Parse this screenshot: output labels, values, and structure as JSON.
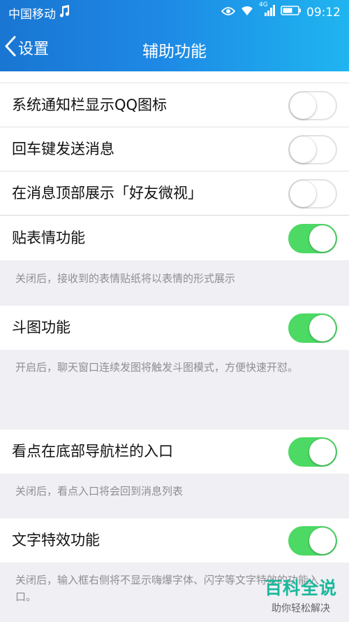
{
  "status_bar": {
    "carrier": "中国移动",
    "network": "4G",
    "time": "09:12"
  },
  "nav": {
    "back_label": "设置",
    "title": "辅助功能"
  },
  "settings": [
    {
      "label": "系统通知栏显示QQ图标",
      "enabled": false
    },
    {
      "label": "回车键发送消息",
      "enabled": false
    },
    {
      "label": "在消息顶部展示「好友微视」",
      "enabled": false
    },
    {
      "label": "贴表情功能",
      "enabled": true,
      "note": "关闭后，接收到的表情贴纸将以表情的形式展示"
    },
    {
      "label": "斗图功能",
      "enabled": true,
      "note": "开启后，聊天窗口连续发图将触发斗图模式，方便快速开怼。"
    },
    {
      "label": "看点在底部导航栏的入口",
      "enabled": true,
      "note": "关闭后，看点入口将会回到消息列表"
    },
    {
      "label": "文字特效功能",
      "enabled": true,
      "note": "关闭后，输入框右侧将不显示嗨爆字体、闪字等文字特效的功能入口。"
    }
  ],
  "watermark": {
    "main": "百科全说",
    "sub": "助你轻松解决"
  },
  "colors": {
    "accent_start": "#1976d2",
    "accent_end": "#1fb5f0",
    "toggle_on": "#4cd964",
    "note_text": "#8e8e93"
  }
}
